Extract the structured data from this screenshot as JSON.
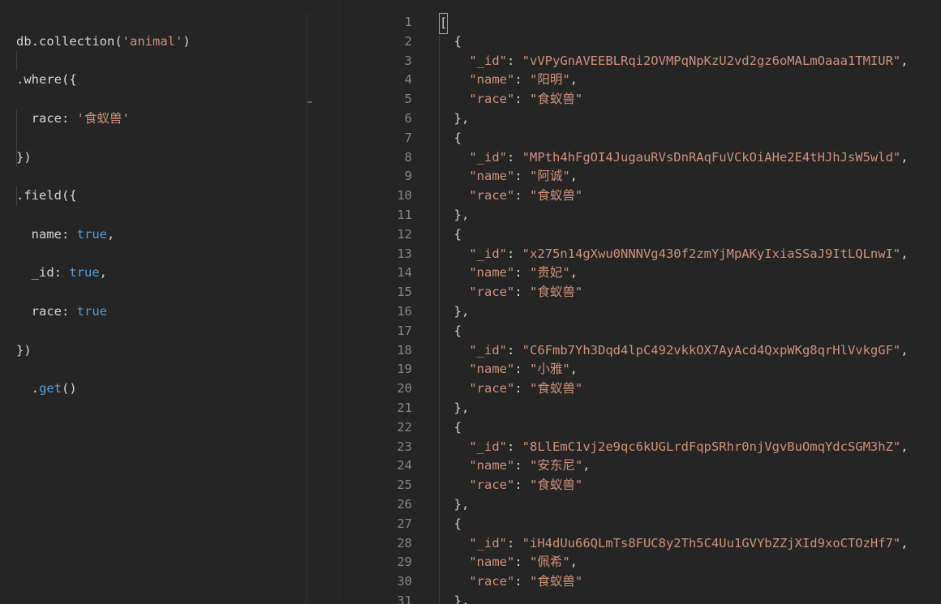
{
  "query": {
    "line1_a": "db.collection(",
    "line1_b": "'animal'",
    "line1_c": ")",
    "line2": ".where({",
    "line3_key": "race: ",
    "line3_val": "'食蚁兽'",
    "line4": "})",
    "line5": ".field({",
    "line6_key": "name: ",
    "line6_val": "true",
    "line6_end": ",",
    "line7_key": "_id: ",
    "line7_val": "true",
    "line7_end": ",",
    "line8_key": "race: ",
    "line8_val": "true",
    "line9": "})",
    "line10_a": ".",
    "line10_b": "get",
    "line10_c": "()"
  },
  "result": {
    "line_numbers": [
      "1",
      "2",
      "3",
      "4",
      "5",
      "6",
      "7",
      "8",
      "9",
      "10",
      "11",
      "12",
      "13",
      "14",
      "15",
      "16",
      "17",
      "18",
      "19",
      "20",
      "21",
      "22",
      "23",
      "24",
      "25",
      "26",
      "27",
      "28",
      "29",
      "30",
      "31"
    ],
    "open_bracket": "[",
    "open_brace": "{",
    "close_brace_comma": "},",
    "id_key": "\"_id\"",
    "name_key": "\"name\"",
    "race_key": "\"race\"",
    "records": [
      {
        "id": "\"vVPyGnAVEEBLRqi2OVMPqNpKzU2vd2gz6oMALmOaaa1TMIUR\"",
        "name": "\"阳明\"",
        "race": "\"食蚁兽\""
      },
      {
        "id": "\"MPth4hFgOI4JugauRVsDnRAqFuVCkOiAHe2E4tHJhJsW5wld\"",
        "name": "\"阿诚\"",
        "race": "\"食蚁兽\""
      },
      {
        "id": "\"x275n14gXwu0NNNVg430f2zmYjMpAKyIxiaSSaJ9ItLQLnwI\"",
        "name": "\"贵妃\"",
        "race": "\"食蚁兽\""
      },
      {
        "id": "\"C6Fmb7Yh3Dqd4lpC492vkkOX7AyAcd4QxpWKg8qrHlVvkgGF\"",
        "name": "\"小雅\"",
        "race": "\"食蚁兽\""
      },
      {
        "id": "\"8LlEmC1vj2e9qc6kUGLrdFqpSRhr0njVgvBuOmqYdcSGM3hZ\"",
        "name": "\"安东尼\"",
        "race": "\"食蚁兽\""
      },
      {
        "id": "\"iH4dUu66QLmTs8FUC8y2Th5C4Uu1GVYbZZjXId9xoCTOzHf7\"",
        "name": "\"佩希\"",
        "race": "\"食蚁兽\""
      }
    ]
  }
}
